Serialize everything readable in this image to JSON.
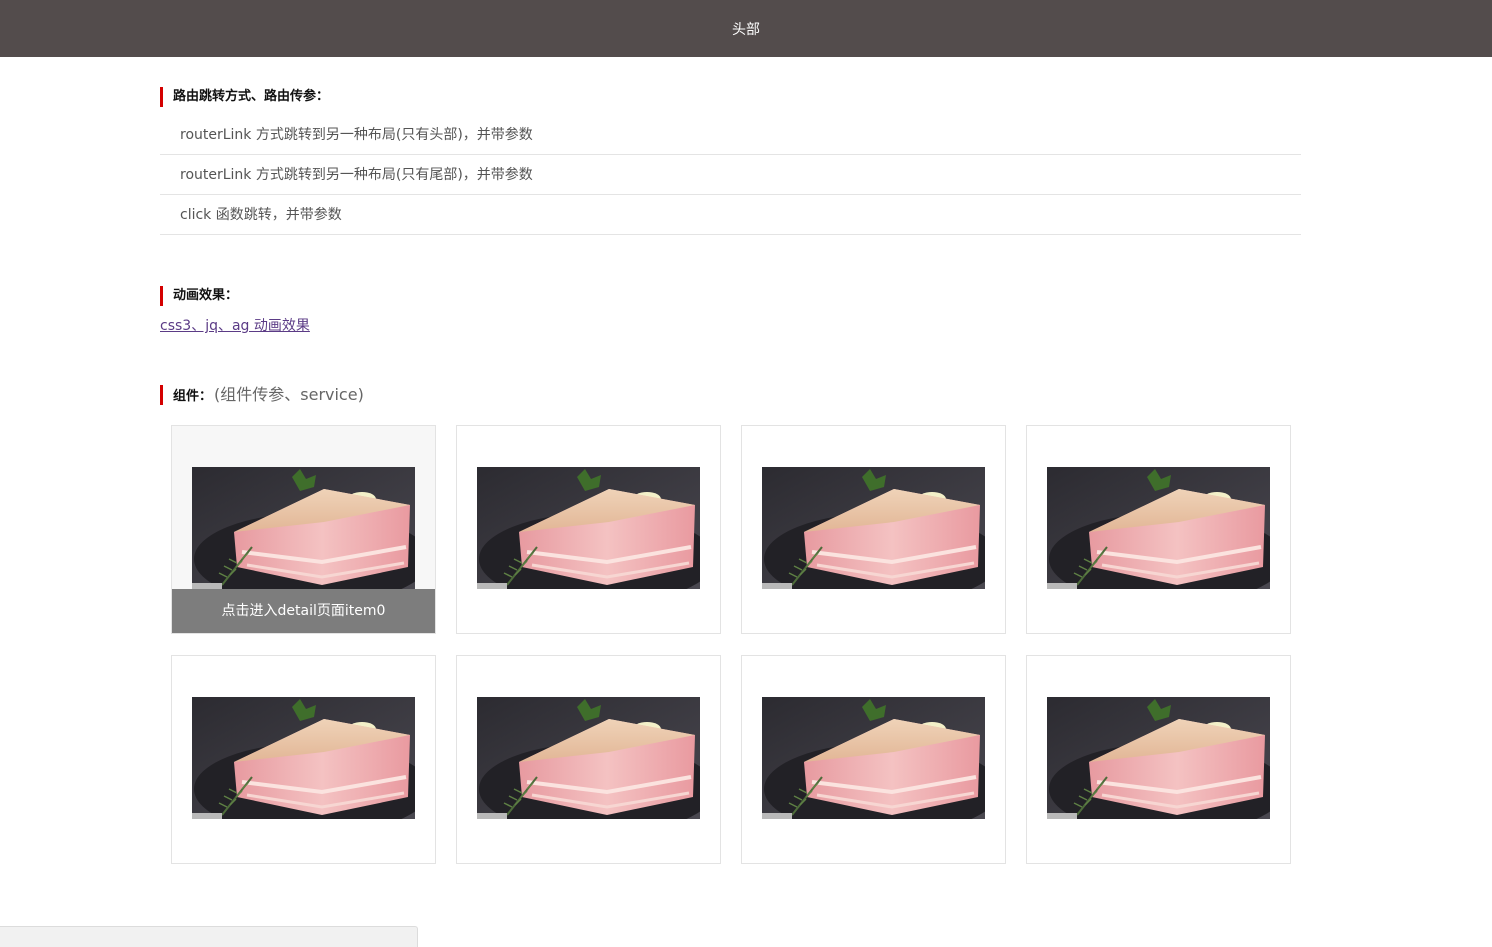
{
  "header": {
    "title": "头部"
  },
  "routing": {
    "title": "路由跳转方式、路由传参：",
    "items": [
      "routerLink 方式跳转到另一种布局(只有头部)，并带参数",
      "routerLink 方式跳转到另一种布局(只有尾部)，并带参数",
      "click 函数跳转，并带参数"
    ]
  },
  "animation": {
    "title": "动画效果：",
    "link": "css3、jq、ag 动画效果"
  },
  "components": {
    "title": "组件：",
    "subtitle": "(组件传参、service)",
    "cards": [
      {
        "image": "pork-belly-photo",
        "caption": "点击进入detail页面item0",
        "hovered": true
      },
      {
        "image": "pork-belly-photo",
        "caption": "",
        "hovered": false
      },
      {
        "image": "pork-belly-photo",
        "caption": "",
        "hovered": false
      },
      {
        "image": "pork-belly-photo",
        "caption": "",
        "hovered": false
      },
      {
        "image": "pork-belly-photo",
        "caption": "",
        "hovered": false
      },
      {
        "image": "pork-belly-photo",
        "caption": "",
        "hovered": false
      },
      {
        "image": "pork-belly-photo",
        "caption": "",
        "hovered": false
      },
      {
        "image": "pork-belly-photo",
        "caption": "",
        "hovered": false
      }
    ]
  },
  "colors": {
    "header_bg": "#534c4c",
    "accent_bar": "#d40000",
    "link": "#5b3b86",
    "caption_bg": "#7d7d7d"
  }
}
